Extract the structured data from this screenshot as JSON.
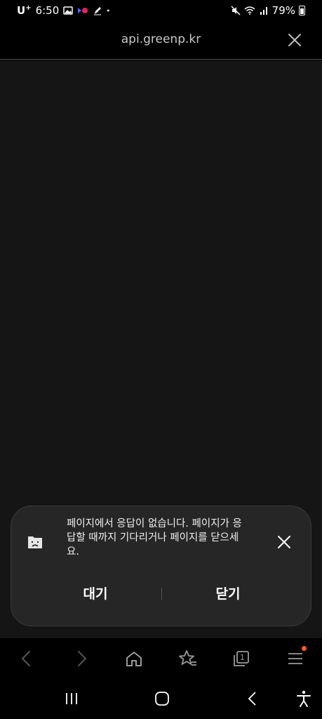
{
  "status_bar": {
    "carrier": "U",
    "carrier_sup": "+",
    "time": "6:50",
    "battery": "79%"
  },
  "url_bar": {
    "url": "api.greenp.kr"
  },
  "dialog": {
    "message": "페이지에서 응답이 없습니다. 페이지가 응답할 때까지 기다리거나 페이지를 닫으세요.",
    "wait_label": "대기",
    "close_label": "닫기"
  },
  "icons": {
    "status": [
      "gallery-icon",
      "youtube-music-icon",
      "pen-icon",
      "dot-icon",
      "mute-icon",
      "wifi-icon",
      "signal-icon",
      "battery-icon"
    ],
    "browser_nav": [
      "back-icon",
      "forward-icon",
      "home-icon",
      "bookmark-icon",
      "tabs-icon",
      "menu-icon"
    ],
    "system_nav": [
      "recent-apps-icon",
      "home-icon",
      "back-icon",
      "accessibility-icon"
    ]
  },
  "browser_nav": {
    "tab_count": "1"
  },
  "colors": {
    "background": "#151515",
    "dialog": "#262626",
    "badge": "#ff5a1f"
  }
}
